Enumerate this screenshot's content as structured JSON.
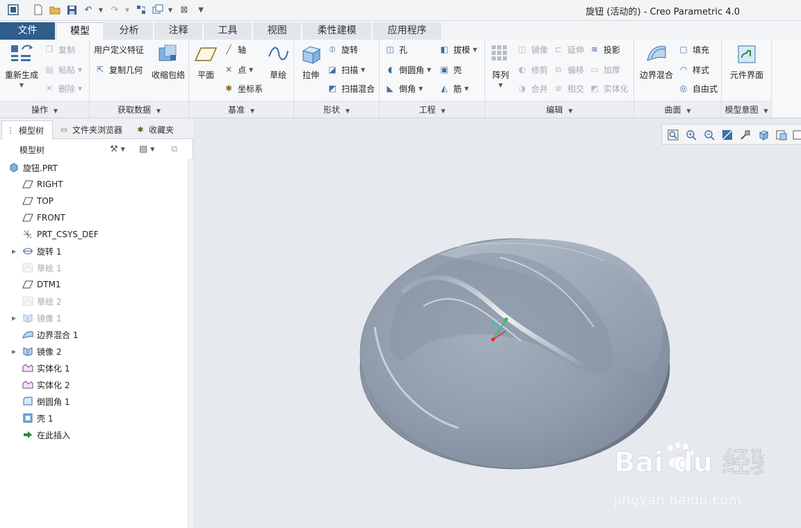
{
  "window": {
    "title": "旋钮 (活动的) - Creo Parametric 4.0"
  },
  "tabs": [
    {
      "label": "文件"
    },
    {
      "label": "模型"
    },
    {
      "label": "分析"
    },
    {
      "label": "注释"
    },
    {
      "label": "工具"
    },
    {
      "label": "视图"
    },
    {
      "label": "柔性建模"
    },
    {
      "label": "应用程序"
    }
  ],
  "active_tab": "模型",
  "ribbon": {
    "operations": {
      "label": "操作",
      "regenerate": "重新生成",
      "copy": "复制",
      "paste": "粘贴",
      "delete": "删除"
    },
    "get_data": {
      "label": "获取数据",
      "udf": "用户定义特征",
      "copy_geom": "复制几何",
      "shrinkwrap": "收缩包络"
    },
    "datum": {
      "label": "基准",
      "plane": "平面",
      "axis": "轴",
      "point": "点",
      "csys": "坐标系",
      "sketch": "草绘"
    },
    "shapes": {
      "label": "形状",
      "extrude": "拉伸",
      "revolve": "旋转",
      "sweep": "扫描",
      "swept_blend": "扫描混合"
    },
    "engineering": {
      "label": "工程",
      "hole": "孔",
      "round": "倒圆角",
      "chamfer": "倒角",
      "draft": "拔模",
      "shell": "壳",
      "rib": "筋"
    },
    "editing": {
      "label": "编辑",
      "pattern": "阵列",
      "mirror": "镜像",
      "extend": "延伸",
      "project": "投影",
      "trim": "修剪",
      "offset": "偏移",
      "thicken": "加厚",
      "merge": "合并",
      "intersect": "相交",
      "solidify": "实体化"
    },
    "surfaces": {
      "label": "曲面",
      "boundary_blend": "边界混合",
      "fill": "填充",
      "style": "样式",
      "freestyle": "自由式"
    },
    "model_intent": {
      "label": "模型意图",
      "component_interface": "元件界面"
    }
  },
  "panel": {
    "tabs": [
      {
        "label": "模型树"
      },
      {
        "label": "文件夹浏览器"
      },
      {
        "label": "收藏夹"
      }
    ],
    "tree_title": "模型树"
  },
  "tree": [
    {
      "label": "旋钮.PRT",
      "icon": "part-icon",
      "dim": false,
      "expandable": false
    },
    {
      "label": "RIGHT",
      "icon": "datum-plane-icon",
      "dim": false,
      "expandable": false
    },
    {
      "label": "TOP",
      "icon": "datum-plane-icon",
      "dim": false,
      "expandable": false
    },
    {
      "label": "FRONT",
      "icon": "datum-plane-icon",
      "dim": false,
      "expandable": false
    },
    {
      "label": "PRT_CSYS_DEF",
      "icon": "csys-icon",
      "dim": false,
      "expandable": false
    },
    {
      "label": "旋转 1",
      "icon": "revolve-icon",
      "dim": false,
      "expandable": true
    },
    {
      "label": "草绘 1",
      "icon": "sketch-icon",
      "dim": true,
      "expandable": false
    },
    {
      "label": "DTM1",
      "icon": "datum-plane-icon",
      "dim": false,
      "expandable": false
    },
    {
      "label": "草绘 2",
      "icon": "sketch-icon",
      "dim": true,
      "expandable": false
    },
    {
      "label": "镜像 1",
      "icon": "mirror-icon",
      "dim": true,
      "expandable": true
    },
    {
      "label": "边界混合 1",
      "icon": "boundary-blend-icon",
      "dim": false,
      "expandable": false
    },
    {
      "label": "镜像 2",
      "icon": "mirror-icon",
      "dim": false,
      "expandable": true
    },
    {
      "label": "实体化 1",
      "icon": "solidify-icon",
      "dim": false,
      "expandable": false
    },
    {
      "label": "实体化 2",
      "icon": "solidify-icon",
      "dim": false,
      "expandable": false
    },
    {
      "label": "倒圆角 1",
      "icon": "round-icon",
      "dim": false,
      "expandable": false
    },
    {
      "label": "壳 1",
      "icon": "shell-icon",
      "dim": false,
      "expandable": false
    },
    {
      "label": "在此插入",
      "icon": "insert-arrow-icon",
      "dim": false,
      "expandable": false
    }
  ],
  "watermark": {
    "logo": "Bai du 经验",
    "url": "jingyan.baidu.com"
  },
  "colors": {
    "file_tab": "#2f5d8c",
    "model_body": "#8d9aab",
    "model_side": "#7a8798",
    "background": "#e6e9ee",
    "accent": "#3e6fa3"
  }
}
